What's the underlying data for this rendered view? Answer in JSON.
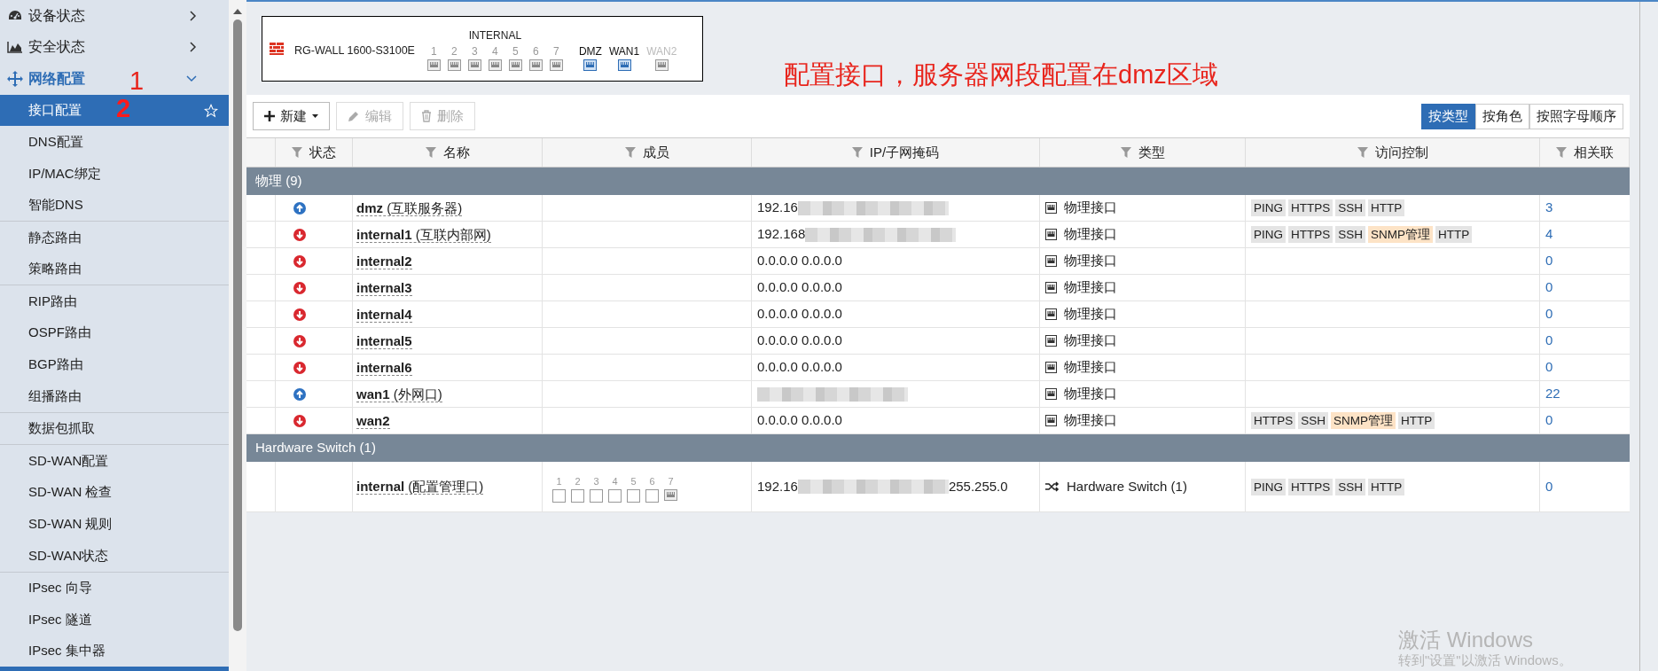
{
  "sidebar": {
    "menus": [
      {
        "label": "设备状态",
        "active": false,
        "expanded": false
      },
      {
        "label": "安全状态",
        "active": false,
        "expanded": false
      },
      {
        "label": "网络配置",
        "active": true,
        "expanded": true,
        "groups": [
          [
            {
              "label": "接口配置",
              "selected": true
            },
            {
              "label": "DNS配置",
              "selected": false
            },
            {
              "label": "IP/MAC绑定",
              "selected": false
            },
            {
              "label": "智能DNS",
              "selected": false
            }
          ],
          [
            {
              "label": "静态路由",
              "selected": false
            },
            {
              "label": "策略路由",
              "selected": false
            }
          ],
          [
            {
              "label": "RIP路由",
              "selected": false
            },
            {
              "label": "OSPF路由",
              "selected": false
            },
            {
              "label": "BGP路由",
              "selected": false
            },
            {
              "label": "组播路由",
              "selected": false
            }
          ],
          [
            {
              "label": "数据包抓取",
              "selected": false
            }
          ],
          [
            {
              "label": "SD-WAN配置",
              "selected": false
            },
            {
              "label": "SD-WAN 检查",
              "selected": false
            },
            {
              "label": "SD-WAN 规则",
              "selected": false
            },
            {
              "label": "SD-WAN状态",
              "selected": false
            }
          ],
          [
            {
              "label": "IPsec 向导",
              "selected": false
            },
            {
              "label": "IPsec 隧道",
              "selected": false
            },
            {
              "label": "IPsec 集中器",
              "selected": false
            }
          ]
        ]
      }
    ]
  },
  "device": {
    "model": "RG-WALL 1600-S3100E",
    "group_label": "INTERNAL",
    "ports": [
      {
        "label": "1",
        "kind": "internal",
        "up": false
      },
      {
        "label": "2",
        "kind": "internal",
        "up": false
      },
      {
        "label": "3",
        "kind": "internal",
        "up": false
      },
      {
        "label": "4",
        "kind": "internal",
        "up": false
      },
      {
        "label": "5",
        "kind": "internal",
        "up": false
      },
      {
        "label": "6",
        "kind": "internal",
        "up": false
      },
      {
        "label": "7",
        "kind": "internal",
        "up": false
      },
      {
        "label": "DMZ",
        "kind": "named",
        "up": true
      },
      {
        "label": "WAN1",
        "kind": "named",
        "up": true
      },
      {
        "label": "WAN2",
        "kind": "named",
        "up": false
      }
    ]
  },
  "toolbar": {
    "buttons": [
      {
        "label": "新建",
        "disabled": false,
        "dropdown": true
      },
      {
        "label": "编辑",
        "disabled": true,
        "dropdown": false
      },
      {
        "label": "删除",
        "disabled": true,
        "dropdown": false
      }
    ],
    "view_tabs": [
      {
        "label": "按类型",
        "selected": true
      },
      {
        "label": "按角色",
        "selected": false
      },
      {
        "label": "按照字母顺序",
        "selected": false
      }
    ]
  },
  "table": {
    "columns": [
      "状态",
      "名称",
      "成员",
      "IP/子网掩码",
      "类型",
      "访问控制",
      "相关联"
    ],
    "groups": [
      {
        "title": "物理 (9)",
        "rows": [
          {
            "up": true,
            "name": "dmz",
            "alias": "(互联服务器)",
            "ip": [
              {
                "kind": "text",
                "text": "192.16"
              },
              {
                "kind": "blur"
              }
            ],
            "kind": "physical",
            "type": "物理接口",
            "access": [
              {
                "label": "PING",
                "highlight": false
              },
              {
                "label": "HTTPS",
                "highlight": false
              },
              {
                "label": "SSH",
                "highlight": false
              },
              {
                "label": "HTTP",
                "highlight": false
              }
            ],
            "refs": "3"
          },
          {
            "up": false,
            "name": "internal1",
            "alias": "(互联内部网)",
            "ip": [
              {
                "kind": "text",
                "text": "192.168"
              },
              {
                "kind": "blur"
              }
            ],
            "kind": "physical",
            "type": "物理接口",
            "access": [
              {
                "label": "PING",
                "highlight": false
              },
              {
                "label": "HTTPS",
                "highlight": false
              },
              {
                "label": "SSH",
                "highlight": false
              },
              {
                "label": "SNMP管理",
                "highlight": true
              },
              {
                "label": "HTTP",
                "highlight": false
              }
            ],
            "refs": "4"
          },
          {
            "up": false,
            "name": "internal2",
            "ip": [
              {
                "kind": "text",
                "text": "0.0.0.0 0.0.0.0"
              }
            ],
            "kind": "physical",
            "type": "物理接口",
            "refs": "0"
          },
          {
            "up": false,
            "name": "internal3",
            "ip": [
              {
                "kind": "text",
                "text": "0.0.0.0 0.0.0.0"
              }
            ],
            "kind": "physical",
            "type": "物理接口",
            "refs": "0"
          },
          {
            "up": false,
            "name": "internal4",
            "ip": [
              {
                "kind": "text",
                "text": "0.0.0.0 0.0.0.0"
              }
            ],
            "kind": "physical",
            "type": "物理接口",
            "refs": "0"
          },
          {
            "up": false,
            "name": "internal5",
            "ip": [
              {
                "kind": "text",
                "text": "0.0.0.0 0.0.0.0"
              }
            ],
            "kind": "physical",
            "type": "物理接口",
            "refs": "0"
          },
          {
            "up": false,
            "name": "internal6",
            "ip": [
              {
                "kind": "text",
                "text": "0.0.0.0 0.0.0.0"
              }
            ],
            "kind": "physical",
            "type": "物理接口",
            "refs": "0"
          },
          {
            "up": true,
            "name": "wan1",
            "alias": "(外网口)",
            "ip": [
              {
                "kind": "blur"
              }
            ],
            "kind": "physical",
            "type": "物理接口",
            "refs": "22"
          },
          {
            "up": false,
            "name": "wan2",
            "ip": [
              {
                "kind": "text",
                "text": "0.0.0.0 0.0.0.0"
              }
            ],
            "kind": "physical",
            "type": "物理接口",
            "access": [
              {
                "label": "HTTPS",
                "highlight": false
              },
              {
                "label": "SSH",
                "highlight": false
              },
              {
                "label": "SNMP管理",
                "highlight": true
              },
              {
                "label": "HTTP",
                "highlight": false
              }
            ],
            "refs": "0"
          }
        ]
      },
      {
        "title": "Hardware Switch (1)",
        "rows": [
          {
            "name": "internal",
            "alias": "(配置管理口)",
            "members": [
              {
                "label": "1",
                "linked": false
              },
              {
                "label": "2",
                "linked": false
              },
              {
                "label": "3",
                "linked": false
              },
              {
                "label": "4",
                "linked": false
              },
              {
                "label": "5",
                "linked": false
              },
              {
                "label": "6",
                "linked": false
              },
              {
                "label": "7",
                "linked": true
              }
            ],
            "ip": [
              {
                "kind": "text",
                "text": "192.16"
              },
              {
                "kind": "blur"
              },
              {
                "kind": "text",
                "text": "255.255.0"
              }
            ],
            "kind": "switch",
            "type": "Hardware Switch (1)",
            "access": [
              {
                "label": "PING",
                "highlight": false
              },
              {
                "label": "HTTPS",
                "highlight": false
              },
              {
                "label": "SSH",
                "highlight": false
              },
              {
                "label": "HTTP",
                "highlight": false
              }
            ],
            "refs": "0"
          }
        ]
      }
    ]
  },
  "annotations": [
    {
      "text": "1"
    },
    {
      "text": "2"
    },
    {
      "text": "配置接口，服务器网段配置在dmz区域"
    }
  ],
  "os_watermark": {
    "title": "激活 Windows",
    "subtitle": "转到\"设置\"以激活 Windows。"
  }
}
